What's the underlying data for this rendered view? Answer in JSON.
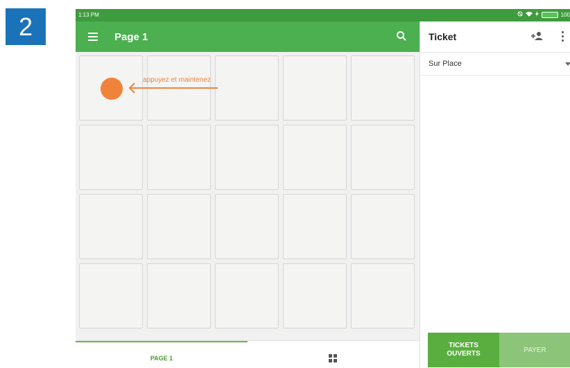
{
  "step_badge": "2",
  "status_bar": {
    "time": "1:13 PM",
    "battery_text": "100"
  },
  "app_bar": {
    "title": "Page 1",
    "menu_icon": "hamburger-menu-icon",
    "search_icon": "search-icon"
  },
  "hint": {
    "text": "appuyez et maintenez"
  },
  "bottom_bar": {
    "tab_label": "PAGE 1",
    "grid_icon": "grid-icon"
  },
  "ticket": {
    "title": "Ticket",
    "dining_option": "Sur Place",
    "open_tickets_label": "TICKETS\nOUVERTS",
    "pay_label": "PAYER"
  },
  "colors": {
    "primary_green": "#4caf50",
    "status_green": "#3e9c3e",
    "hint_orange": "#f0833a",
    "badge_blue": "#1a73b8",
    "pay_green_disabled": "#8cc47a"
  }
}
